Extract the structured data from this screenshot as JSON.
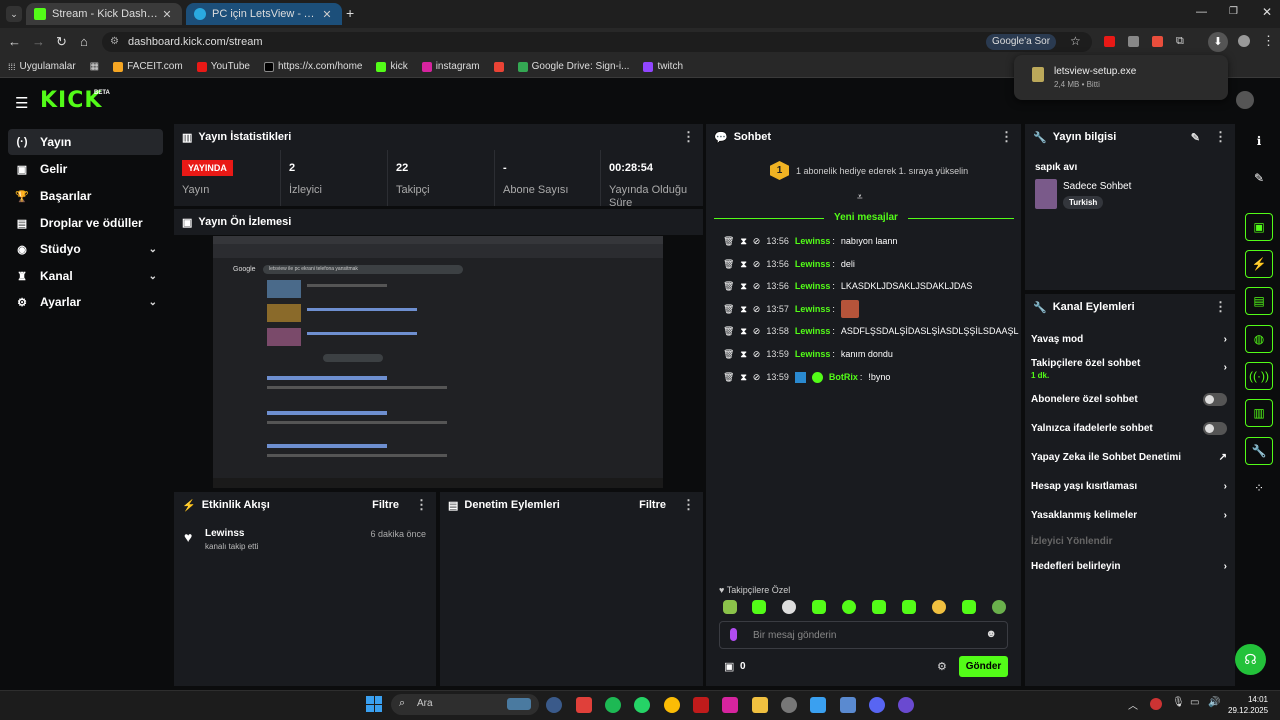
{
  "browser": {
    "tabs": [
      {
        "title": "Stream - Kick Dashboard",
        "active": true
      },
      {
        "title": "PC için LetsView - Android/iPhone",
        "active": false
      }
    ],
    "url": "dashboard.kick.com/stream",
    "ask_google": "Google'a Sor",
    "bookmarks": [
      "Uygulamalar",
      "FACEIT.com",
      "YouTube",
      "https://x.com/home",
      "kick",
      "instagram",
      "Google Drive: Sign-i...",
      "twitch"
    ],
    "download": {
      "file": "letsview-setup.exe",
      "meta": "2,4 MB • Bitti"
    }
  },
  "kick": {
    "logo": "KICK",
    "beta": "BETA"
  },
  "sidebar": {
    "items": [
      {
        "label": "Yayın",
        "icon": "broadcast-icon",
        "chevron": false
      },
      {
        "label": "Gelir",
        "icon": "income-icon",
        "chevron": false
      },
      {
        "label": "Başarılar",
        "icon": "trophy-icon",
        "chevron": false
      },
      {
        "label": "Droplar ve ödüller",
        "icon": "gift-icon",
        "chevron": false
      },
      {
        "label": "Stüdyo",
        "icon": "studio-icon",
        "chevron": true
      },
      {
        "label": "Kanal",
        "icon": "channel-icon",
        "chevron": true
      },
      {
        "label": "Ayarlar",
        "icon": "gear-icon",
        "chevron": true
      }
    ]
  },
  "stats": {
    "title": "Yayın İstatistikleri",
    "live_badge": "YAYINDA",
    "items": [
      {
        "value": "",
        "label": "Yayın"
      },
      {
        "value": "2",
        "label": "İzleyici"
      },
      {
        "value": "22",
        "label": "Takipçi"
      },
      {
        "value": "-",
        "label": "Abone Sayısı"
      },
      {
        "value": "00:28:54",
        "label": "Yayında Olduğu Süre"
      }
    ]
  },
  "preview": {
    "title": "Yayın Ön İzlemesi",
    "search_text": "letsview ile pc ekrani telefona yansitmak"
  },
  "activity": {
    "title": "Etkinlik Akışı",
    "filter": "Filtre",
    "events": [
      {
        "user": "Lewinss",
        "action": "kanalı takip etti",
        "time": "6 dakika önce"
      }
    ]
  },
  "moderation": {
    "title": "Denetim Eylemleri",
    "filter": "Filtre"
  },
  "chat": {
    "title": "Sohbet",
    "promo_count": "1",
    "promo_text": "1 abonelik hediye ederek 1. sıraya yükselin",
    "new_messages": "Yeni mesajlar",
    "messages": [
      {
        "time": "13:56",
        "user": "Lewinss",
        "text": "nabıyon laann"
      },
      {
        "time": "13:56",
        "user": "Lewinss",
        "text": "deli"
      },
      {
        "time": "13:56",
        "user": "Lewinss",
        "text": "LKASDKLJDSAKLJSDAKLJDAS"
      },
      {
        "time": "13:57",
        "user": "Lewinss",
        "text": ""
      },
      {
        "time": "13:58",
        "user": "Lewinss",
        "text": "ASDFLŞSDALŞİDASLŞİASDLŞŞİLSDAAŞL"
      },
      {
        "time": "13:59",
        "user": "Lewinss",
        "text": "kanım dondu"
      },
      {
        "time": "13:59",
        "user": "BotRix",
        "text": "!byno"
      }
    ],
    "followers_only_label": "Takipçilere Özel",
    "input_placeholder": "Bir mesaj gönderin",
    "points": "0",
    "send": "Gönder"
  },
  "stream_info": {
    "title": "Yayın bilgisi",
    "stream_title": "sapık avı",
    "category": "Sadece Sohbet",
    "tag": "Turkish"
  },
  "channel_actions": {
    "title": "Kanal Eylemleri",
    "items": [
      {
        "label": "Yavaş mod",
        "type": "chevron"
      },
      {
        "label": "Takipçilere özel sohbet",
        "sub": "1 dk.",
        "type": "chevron"
      },
      {
        "label": "Abonelere özel sohbet",
        "type": "toggle"
      },
      {
        "label": "Yalnızca ifadelerle sohbet",
        "type": "toggle"
      },
      {
        "label": "Yapay Zeka ile Sohbet Denetimi",
        "type": "external"
      },
      {
        "label": "Hesap yaşı kısıtlaması",
        "type": "chevron"
      },
      {
        "label": "Yasaklanmış kelimeler",
        "type": "chevron"
      },
      {
        "label": "İzleyici Yönlendir",
        "type": "disabled"
      },
      {
        "label": "Hedefleri belirleyin",
        "type": "chevron"
      }
    ]
  },
  "taskbar": {
    "search": "Ara",
    "time": "14:01",
    "date": "29.12.2025"
  },
  "colors": {
    "kick_green": "#53fc18",
    "live_red": "#e91916",
    "panel": "#191b1f"
  }
}
